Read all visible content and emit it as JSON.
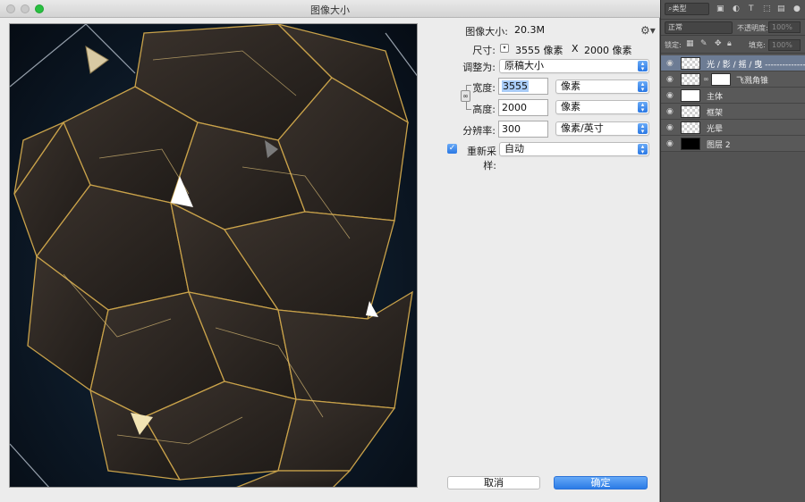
{
  "window": {
    "title": "图像大小"
  },
  "image_size": {
    "label": "图像大小:",
    "value": "20.3M"
  },
  "dimensions": {
    "label": "尺寸:",
    "width": "3555 像素",
    "sep": "X",
    "height": "2000 像素"
  },
  "fit_to": {
    "label": "调整为:",
    "value": "原稿大小"
  },
  "width": {
    "label": "宽度:",
    "value": "3555",
    "unit": "像素"
  },
  "height": {
    "label": "高度:",
    "value": "2000",
    "unit": "像素"
  },
  "resolution": {
    "label": "分辨率:",
    "value": "300",
    "unit": "像素/英寸"
  },
  "resample": {
    "label": "重新采样:",
    "checked": true,
    "value": "自动"
  },
  "buttons": {
    "cancel": "取消",
    "ok": "确定"
  },
  "icons": {
    "gear": "gear-icon",
    "chain": "link-icon",
    "eye": "eye-icon",
    "checkbox": "checkmark-icon",
    "dropdown": "chevron-updown-icon"
  },
  "layers_panel": {
    "filter_label": "类型",
    "blend_mode": "正常",
    "opacity_label": "不透明度:",
    "opacity_value": "100%",
    "lock_label": "锁定:",
    "fill_label": "填充:",
    "fill_value": "100%",
    "layers": [
      {
        "name": "光 / 影 / 摇 / 曳 -------------- ...",
        "active": true
      },
      {
        "name": "飞溅角锥",
        "mask": true
      },
      {
        "name": "主体"
      },
      {
        "name": "框架"
      },
      {
        "name": "光晕"
      },
      {
        "name": "图层 2",
        "black": true
      }
    ]
  },
  "colors": {
    "accent": "#2b7be6",
    "panel_bg": "#535353",
    "dialog_bg": "#ececec",
    "active_layer": "#6d7c94",
    "gold": "#c9a24a"
  }
}
